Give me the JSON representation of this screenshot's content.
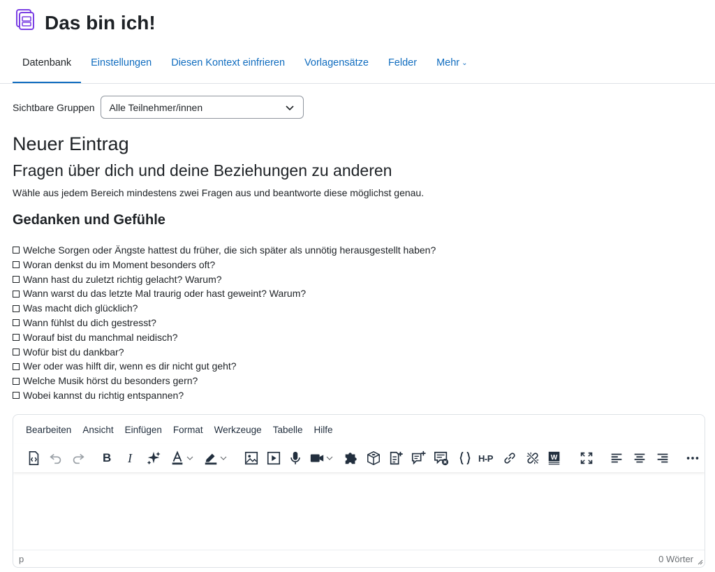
{
  "header": {
    "title": "Das bin ich!",
    "icon": "database-icon",
    "accent_color": "#7b3fe4"
  },
  "tabs": [
    {
      "label": "Datenbank",
      "active": true
    },
    {
      "label": "Einstellungen"
    },
    {
      "label": "Diesen Kontext einfrieren"
    },
    {
      "label": "Vorlagensätze"
    },
    {
      "label": "Felder"
    },
    {
      "label": "Mehr",
      "has_dropdown": true
    }
  ],
  "groups": {
    "label": "Sichtbare Gruppen",
    "selected": "Alle Teilnehmer/innen"
  },
  "entry": {
    "heading": "Neuer Eintrag",
    "subheading": "Fragen über dich und deine Beziehungen zu anderen",
    "intro": "Wähle aus jedem Bereich mindestens zwei Fragen aus und beantworte diese möglichst genau.",
    "section_title": "Gedanken und Gefühle",
    "questions": [
      "Welche Sorgen oder Ängste hattest du früher, die sich später als unnötig herausgestellt haben?",
      "Woran denkst du im Moment besonders oft?",
      "Wann hast du zuletzt richtig gelacht? Warum?",
      "Wann warst du das letzte Mal traurig oder hast geweint? Warum?",
      "Was macht dich glücklich?",
      "Wann fühlst du dich gestresst?",
      "Worauf bist du manchmal neidisch?",
      "Wofür bist du dankbar?",
      "Wer oder was hilft dir, wenn es dir nicht gut geht?",
      "Welche Musik hörst du besonders gern?",
      "Wobei kannst du richtig entspannen?"
    ]
  },
  "editor": {
    "menu": [
      "Bearbeiten",
      "Ansicht",
      "Einfügen",
      "Format",
      "Werkzeuge",
      "Tabelle",
      "Hilfe"
    ],
    "toolbar_icons": [
      "source-code-icon",
      "undo-icon",
      "redo-icon",
      "bold-icon",
      "italic-icon",
      "ai-sparkle-icon",
      "text-color-icon",
      "highlight-color-icon",
      "image-icon",
      "media-icon",
      "microphone-icon",
      "video-camera-icon",
      "puzzle-icon",
      "block-icon",
      "content-add-icon",
      "chat-add-icon",
      "chat-remove-icon",
      "braces-icon",
      "h5p-icon",
      "link-icon",
      "unlink-icon",
      "word-import-icon",
      "fullscreen-icon",
      "align-left-icon",
      "align-center-icon",
      "align-right-icon",
      "more-icon"
    ],
    "bold_label": "B",
    "italic_label": "I",
    "h5p_label": "H-P",
    "status_path": "p",
    "word_count": "0 Wörter"
  }
}
